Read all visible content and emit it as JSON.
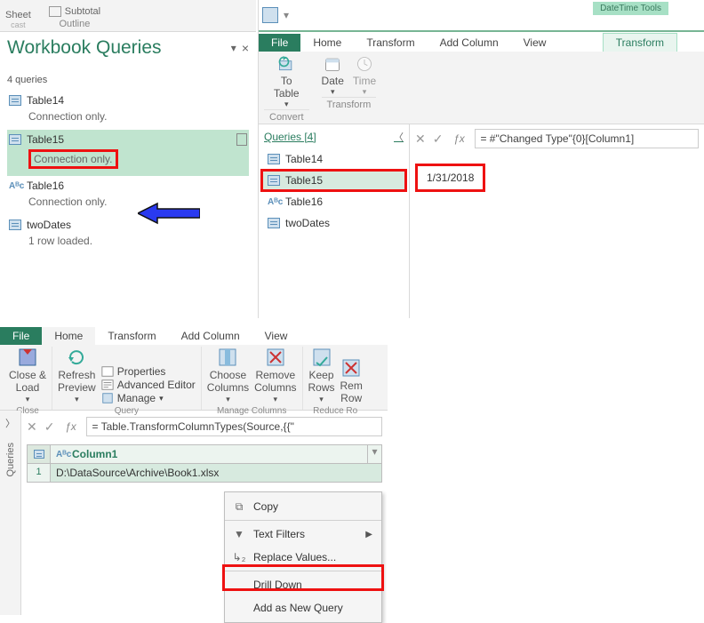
{
  "excel_strip": {
    "sheet_label": "Sheet",
    "subtotal_label": "Subtotal",
    "outline_group": "Outline"
  },
  "wq": {
    "title": "Workbook Queries",
    "count": "4 queries",
    "items": [
      {
        "name": "Table14",
        "sub": "Connection only."
      },
      {
        "name": "Table15",
        "sub": "Connection only."
      },
      {
        "name": "Table16",
        "sub": "Connection only."
      },
      {
        "name": "twoDates",
        "sub": "1 row loaded."
      }
    ]
  },
  "pq_top": {
    "tool_tag": "DateTime Tools",
    "tabs": {
      "file": "File",
      "home": "Home",
      "transform": "Transform",
      "addcol": "Add Column",
      "view": "View",
      "context": "Transform"
    },
    "ribbon": {
      "to_table": "To\nTable",
      "date": "Date",
      "time": "Time",
      "convert_group": "Convert",
      "transform_group": "Transform"
    },
    "queries_header": "Queries [4]",
    "qlist": [
      "Table14",
      "Table15",
      "Table16",
      "twoDates"
    ],
    "formula": "= #\"Changed Type\"{0}[Column1]",
    "value": "1/31/2018"
  },
  "pq_bottom": {
    "tabs": {
      "file": "File",
      "home": "Home",
      "transform": "Transform",
      "addcol": "Add Column",
      "view": "View"
    },
    "ribbon": {
      "close_load": "Close &\nLoad",
      "refresh": "Refresh\nPreview",
      "properties": "Properties",
      "advanced": "Advanced Editor",
      "manage": "Manage",
      "choose_cols": "Choose\nColumns",
      "remove_cols": "Remove\nColumns",
      "keep_rows": "Keep\nRows",
      "remove_rows": "Rem\nRow",
      "close_group": "Close",
      "query_group": "Query",
      "manage_cols_group": "Manage Columns",
      "reduce_rows_group": "Reduce Ro"
    },
    "sidebar": "Queries",
    "formula": "= Table.TransformColumnTypes(Source,{{\"",
    "col_header": "Column1",
    "row1": "D:\\DataSource\\Archive\\Book1.xlsx"
  },
  "context_menu": {
    "copy": "Copy",
    "text_filters": "Text Filters",
    "replace": "Replace Values...",
    "drill": "Drill Down",
    "addq": "Add as New Query"
  }
}
